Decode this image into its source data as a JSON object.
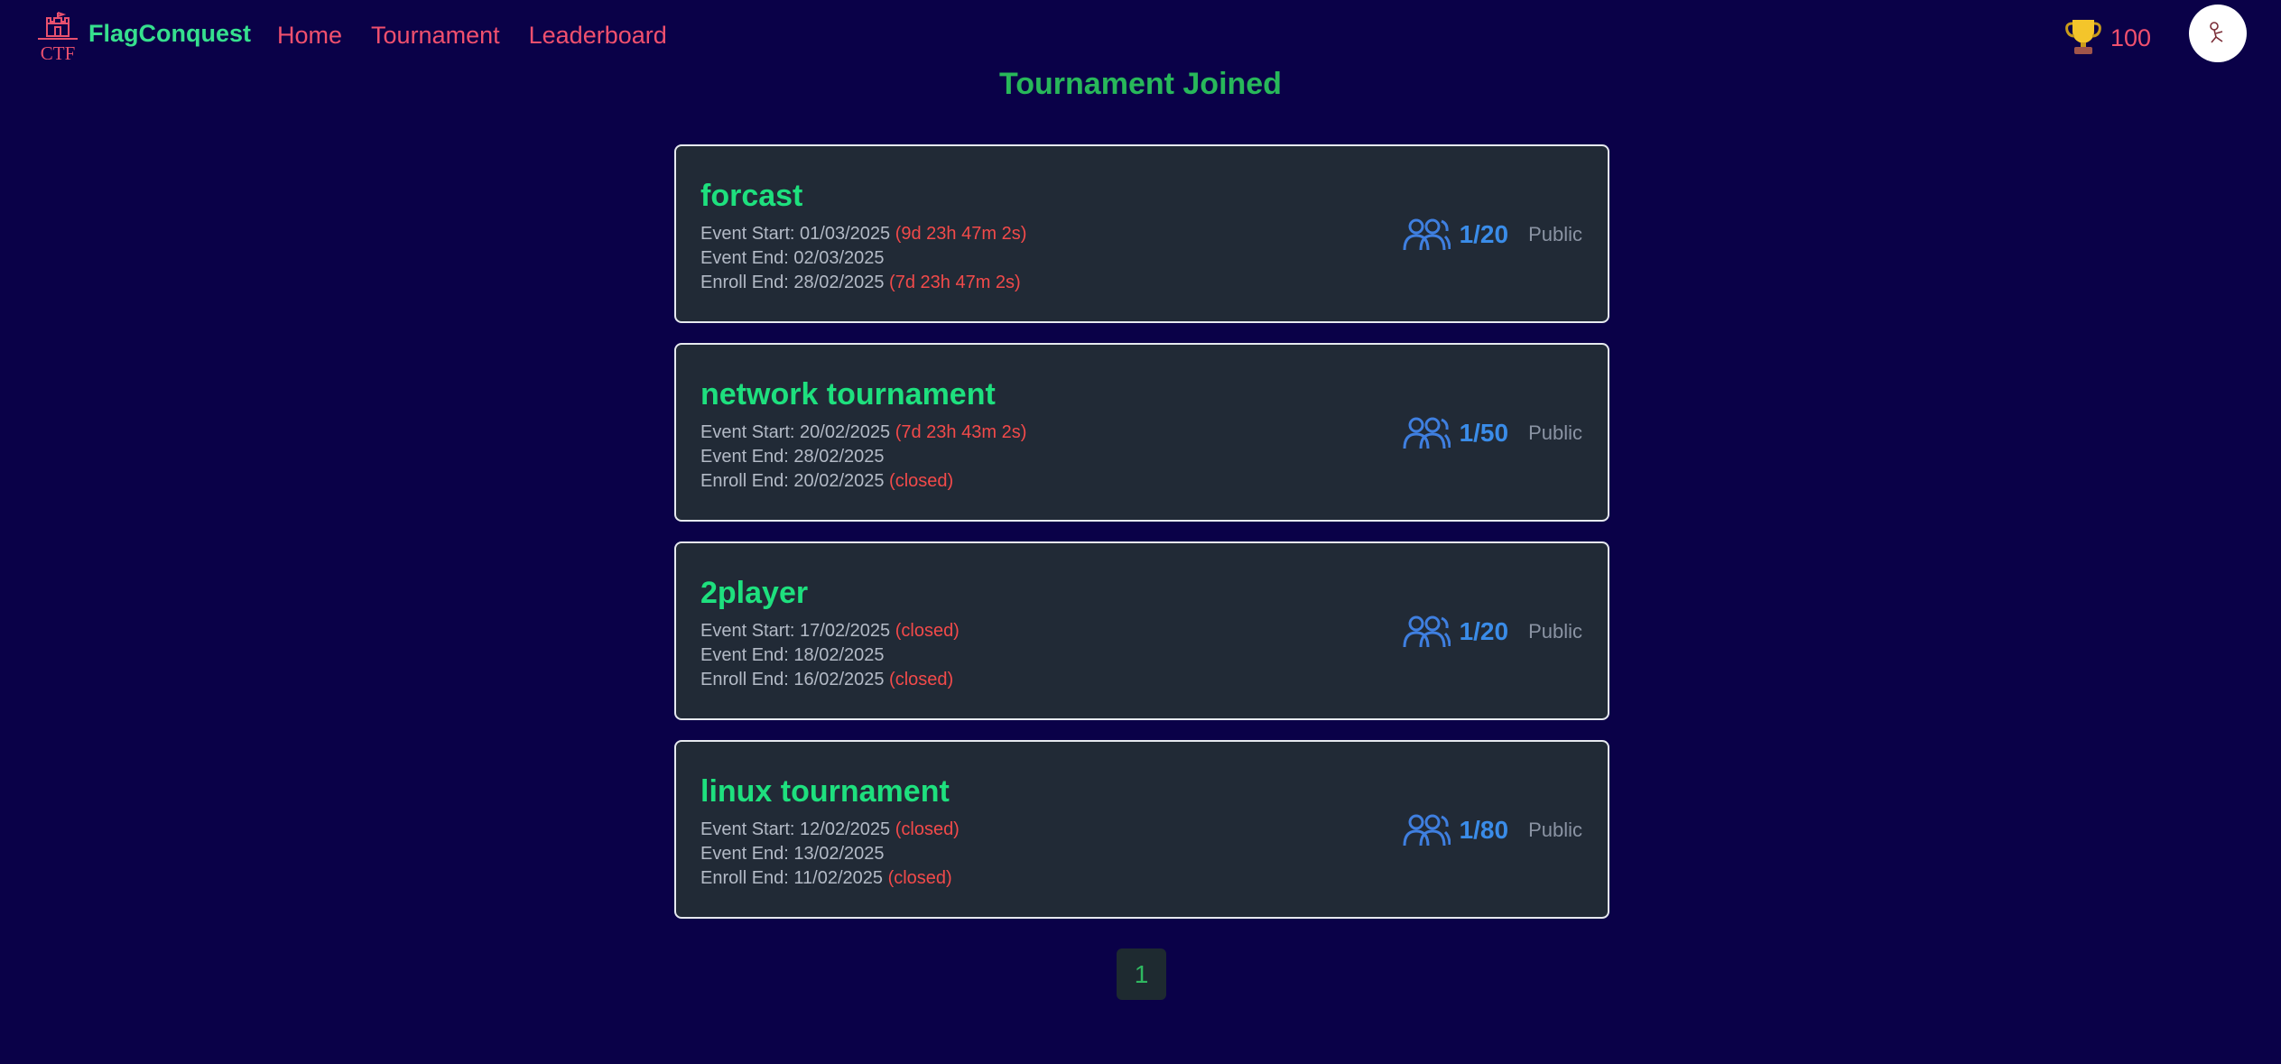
{
  "nav": {
    "logo_text": "CTF",
    "brand": "FlagConquest",
    "links": [
      "Home",
      "Tournament",
      "Leaderboard"
    ],
    "score": "100"
  },
  "page": {
    "title": "Tournament Joined"
  },
  "tournaments": [
    {
      "name": "forcast",
      "event_start_label": "Event Start: 01/03/2025",
      "event_start_note": " (9d 23h 47m 2s)",
      "event_end_label": "Event End: 02/03/2025",
      "enroll_end_label": "Enroll End: 28/02/2025",
      "enroll_end_note": " (7d 23h 47m 2s)",
      "count": "1/20",
      "visibility": "Public"
    },
    {
      "name": "network tournament",
      "event_start_label": "Event Start: 20/02/2025",
      "event_start_note": " (7d 23h 43m 2s)",
      "event_end_label": "Event End: 28/02/2025",
      "enroll_end_label": "Enroll End: 20/02/2025",
      "enroll_end_note": " (closed)",
      "count": "1/50",
      "visibility": "Public"
    },
    {
      "name": "2player",
      "event_start_label": "Event Start: 17/02/2025",
      "event_start_note": " (closed)",
      "event_end_label": "Event End: 18/02/2025",
      "enroll_end_label": "Enroll End: 16/02/2025",
      "enroll_end_note": " (closed)",
      "count": "1/20",
      "visibility": "Public"
    },
    {
      "name": "linux tournament",
      "event_start_label": "Event Start: 12/02/2025",
      "event_start_note": " (closed)",
      "event_end_label": "Event End: 13/02/2025",
      "enroll_end_label": "Enroll End: 11/02/2025",
      "enroll_end_note": " (closed)",
      "count": "1/80",
      "visibility": "Public"
    }
  ],
  "pagination": {
    "current": "1"
  },
  "icons": {
    "logo": "castle-ctf-icon",
    "score": "trophy-icon",
    "avatar": "user-avatar-icon",
    "participants": "people-icon"
  },
  "colors": {
    "background": "#0a0148",
    "brand": "#36e08e",
    "nav_link": "#f0506e",
    "title": "#28b85a",
    "card_bg": "#212a36",
    "card_name": "#1ee07e",
    "countdown": "#f24a4a",
    "count": "#3a8ce8"
  }
}
